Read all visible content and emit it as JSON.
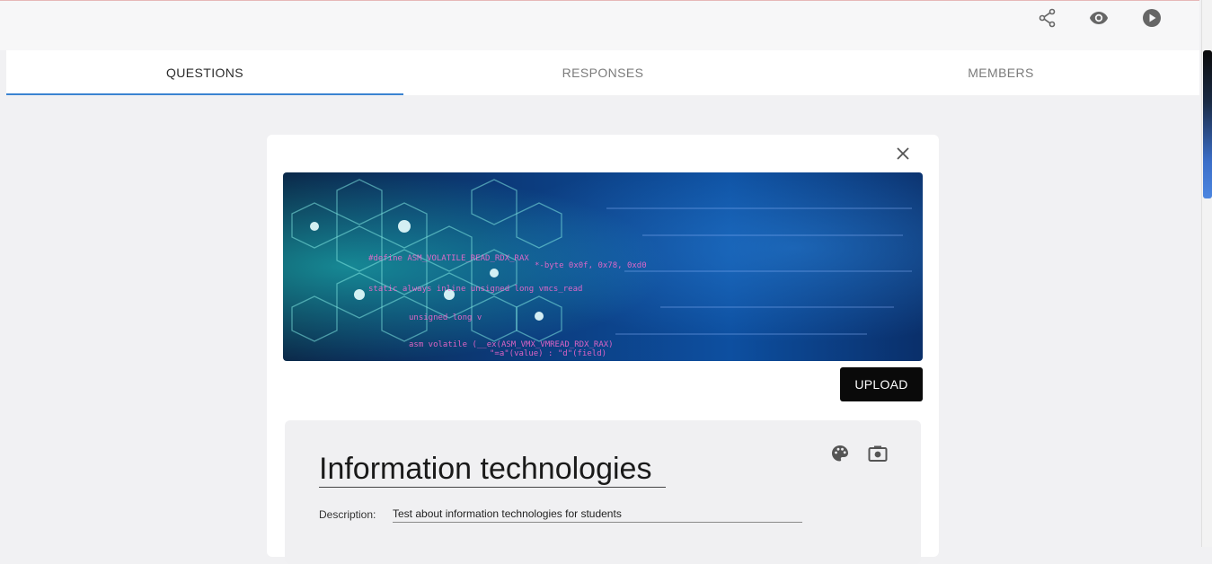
{
  "tabs": [
    {
      "label": "QUESTIONS",
      "active": true
    },
    {
      "label": "RESPONSES",
      "active": false
    },
    {
      "label": "MEMBERS",
      "active": false
    }
  ],
  "toolbar": {
    "icons": [
      "share-icon",
      "eye-icon",
      "play-icon"
    ]
  },
  "banner": {
    "code_lines": [
      "#define ASM_VOLATILE_READ_RDX_RAX",
      "static always inline unsigned long vmcs_read",
      "unsigned long v",
      "asm volatile (__ex(ASM_VMX_VMREAD_RDX_RAX)",
      "\"=a\"(value) : \"d\"(field)",
      "*-byte 0x0f, 0x78, 0xd0"
    ]
  },
  "actions": {
    "upload_label": "UPLOAD"
  },
  "form": {
    "title": "Information technologies",
    "description_label": "Description:",
    "description_value": "Test about information technologies for students"
  },
  "colors": {
    "tab_indicator": "#3b83d1",
    "upload_bg": "#0a0a0a",
    "page_bg": "#f1f1f3"
  }
}
